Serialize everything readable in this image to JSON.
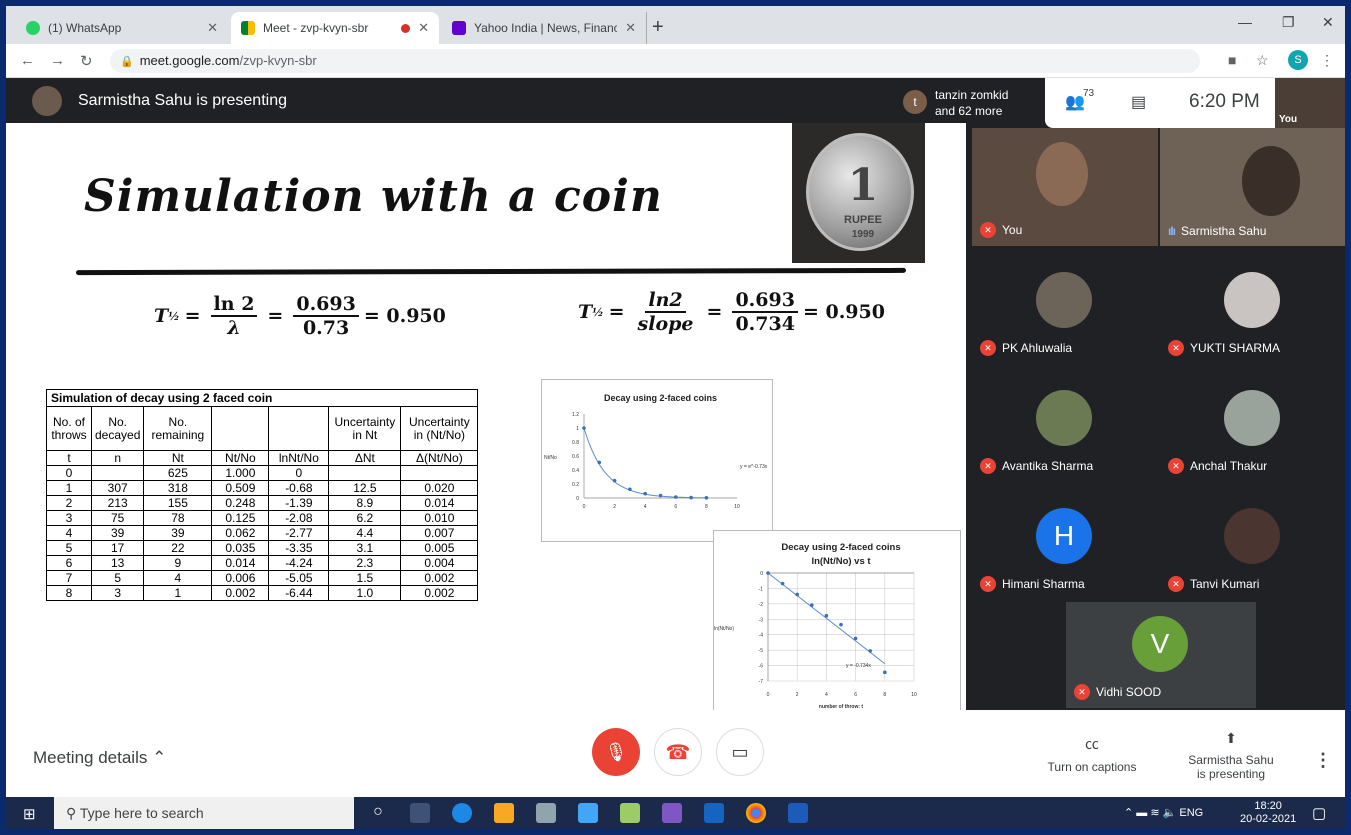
{
  "browser": {
    "tabs": [
      {
        "title": "(1) WhatsApp",
        "active": false
      },
      {
        "title": "Meet - zvp-kvyn-sbr",
        "active": true
      },
      {
        "title": "Yahoo India | News, Finance, Cric",
        "active": false
      }
    ],
    "url_host": "meet.google.com",
    "url_path": "/zvp-kvyn-sbr",
    "profile_initial": "S"
  },
  "meet": {
    "presenting_banner": "Sarmistha Sahu is presenting",
    "joined_initial": "t",
    "joined_line1": "tanzin zomkid",
    "joined_line2": "and 62 more",
    "people_count": "73",
    "time": "6:20 PM",
    "self_label": "You",
    "participants": [
      {
        "name": "You",
        "muted": true
      },
      {
        "name": "Sarmistha Sahu",
        "muted": false,
        "speaking": true
      },
      {
        "name": "PK Ahluwalia",
        "muted": true
      },
      {
        "name": "YUKTI SHARMA",
        "muted": true
      },
      {
        "name": "Avantika Sharma",
        "muted": true
      },
      {
        "name": "Anchal Thakur",
        "muted": true
      },
      {
        "name": "Himani Sharma",
        "muted": true,
        "initial": "H"
      },
      {
        "name": "Tanvi Kumari",
        "muted": true
      },
      {
        "name": "Vidhi SOOD",
        "muted": true,
        "initial": "V"
      }
    ],
    "bottom": {
      "meeting_details": "Meeting details",
      "captions": "Turn on captions",
      "presenting_line1": "Sarmistha Sahu",
      "presenting_line2": "is presenting"
    }
  },
  "slide": {
    "title": "Simulation with a coin",
    "coin": {
      "denomination": "1",
      "text": "RUPEE",
      "year": "1999"
    },
    "formula1": {
      "lhs": "T",
      "sub": "½",
      "num1": "ln 2",
      "den1": "λ",
      "num2": "0.693",
      "den2": "0.73",
      "result": "= 0.950"
    },
    "formula2": {
      "lhs": "T",
      "sub": "½",
      "num1": "ln2",
      "den1": "slope",
      "num2": "0.693",
      "den2": "0.734",
      "result": "= 0.950"
    },
    "table": {
      "caption": "Simulation of decay using 2 faced coin",
      "headers": [
        "No. of throws",
        "No. decayed",
        "No. remaining",
        "",
        "",
        "Uncertainty in Nt",
        "Uncertainty in (Nt/No)"
      ],
      "symbols": [
        "t",
        "n",
        "Nt",
        "Nt/No",
        "lnNt/No",
        "ΔNt",
        "Δ(Nt/No)"
      ],
      "rows": [
        [
          "0",
          "",
          "625",
          "1.000",
          "0",
          "",
          ""
        ],
        [
          "1",
          "307",
          "318",
          "0.509",
          "-0.68",
          "12.5",
          "0.020"
        ],
        [
          "2",
          "213",
          "155",
          "0.248",
          "-1.39",
          "8.9",
          "0.014"
        ],
        [
          "3",
          "75",
          "78",
          "0.125",
          "-2.08",
          "6.2",
          "0.010"
        ],
        [
          "4",
          "39",
          "39",
          "0.062",
          "-2.77",
          "4.4",
          "0.007"
        ],
        [
          "5",
          "17",
          "22",
          "0.035",
          "-3.35",
          "3.1",
          "0.005"
        ],
        [
          "6",
          "13",
          "9",
          "0.014",
          "-4.24",
          "2.3",
          "0.004"
        ],
        [
          "7",
          "5",
          "4",
          "0.006",
          "-5.05",
          "1.5",
          "0.002"
        ],
        [
          "8",
          "3",
          "1",
          "0.002",
          "-6.44",
          "1.0",
          "0.002"
        ]
      ]
    }
  },
  "chart_data": [
    {
      "type": "scatter",
      "title": "Decay  using 2-faced coins",
      "ylabel": "Nt/No",
      "x": [
        0,
        1,
        2,
        3,
        4,
        5,
        6,
        7,
        8
      ],
      "y": [
        1.0,
        0.509,
        0.248,
        0.125,
        0.062,
        0.035,
        0.014,
        0.006,
        0.002
      ],
      "xlim": [
        0,
        10
      ],
      "ylim": [
        0,
        1.2
      ],
      "xticks": [
        "0",
        "2",
        "4",
        "6",
        "8",
        "10"
      ],
      "yticks": [
        "0",
        "0.2",
        "0.4",
        "0.6",
        "0.8",
        "1",
        "1.2"
      ],
      "trendline": "exponential",
      "annotation": "y = e^-0.73x"
    },
    {
      "type": "scatter",
      "title": "Decay using 2-faced coins",
      "subtitle": "ln(Nt/No) vs t",
      "xlabel": "number of throw: t",
      "ylabel": "ln(Nt/No)",
      "x": [
        0,
        1,
        2,
        3,
        4,
        5,
        6,
        7,
        8
      ],
      "y": [
        0,
        -0.68,
        -1.39,
        -2.08,
        -2.77,
        -3.35,
        -4.24,
        -5.05,
        -6.44
      ],
      "xlim": [
        0,
        10
      ],
      "ylim": [
        -7,
        0
      ],
      "xticks": [
        "0",
        "2",
        "4",
        "6",
        "8",
        "10"
      ],
      "yticks": [
        "0",
        "-1",
        "-2",
        "-3",
        "-4",
        "-5",
        "-6",
        "-7"
      ],
      "trendline": "linear",
      "annotation": "y = -0.734x"
    }
  ],
  "taskbar": {
    "search_placeholder": "Type here to search",
    "lang": "ENG",
    "time": "18:20",
    "date": "20-02-2021"
  }
}
